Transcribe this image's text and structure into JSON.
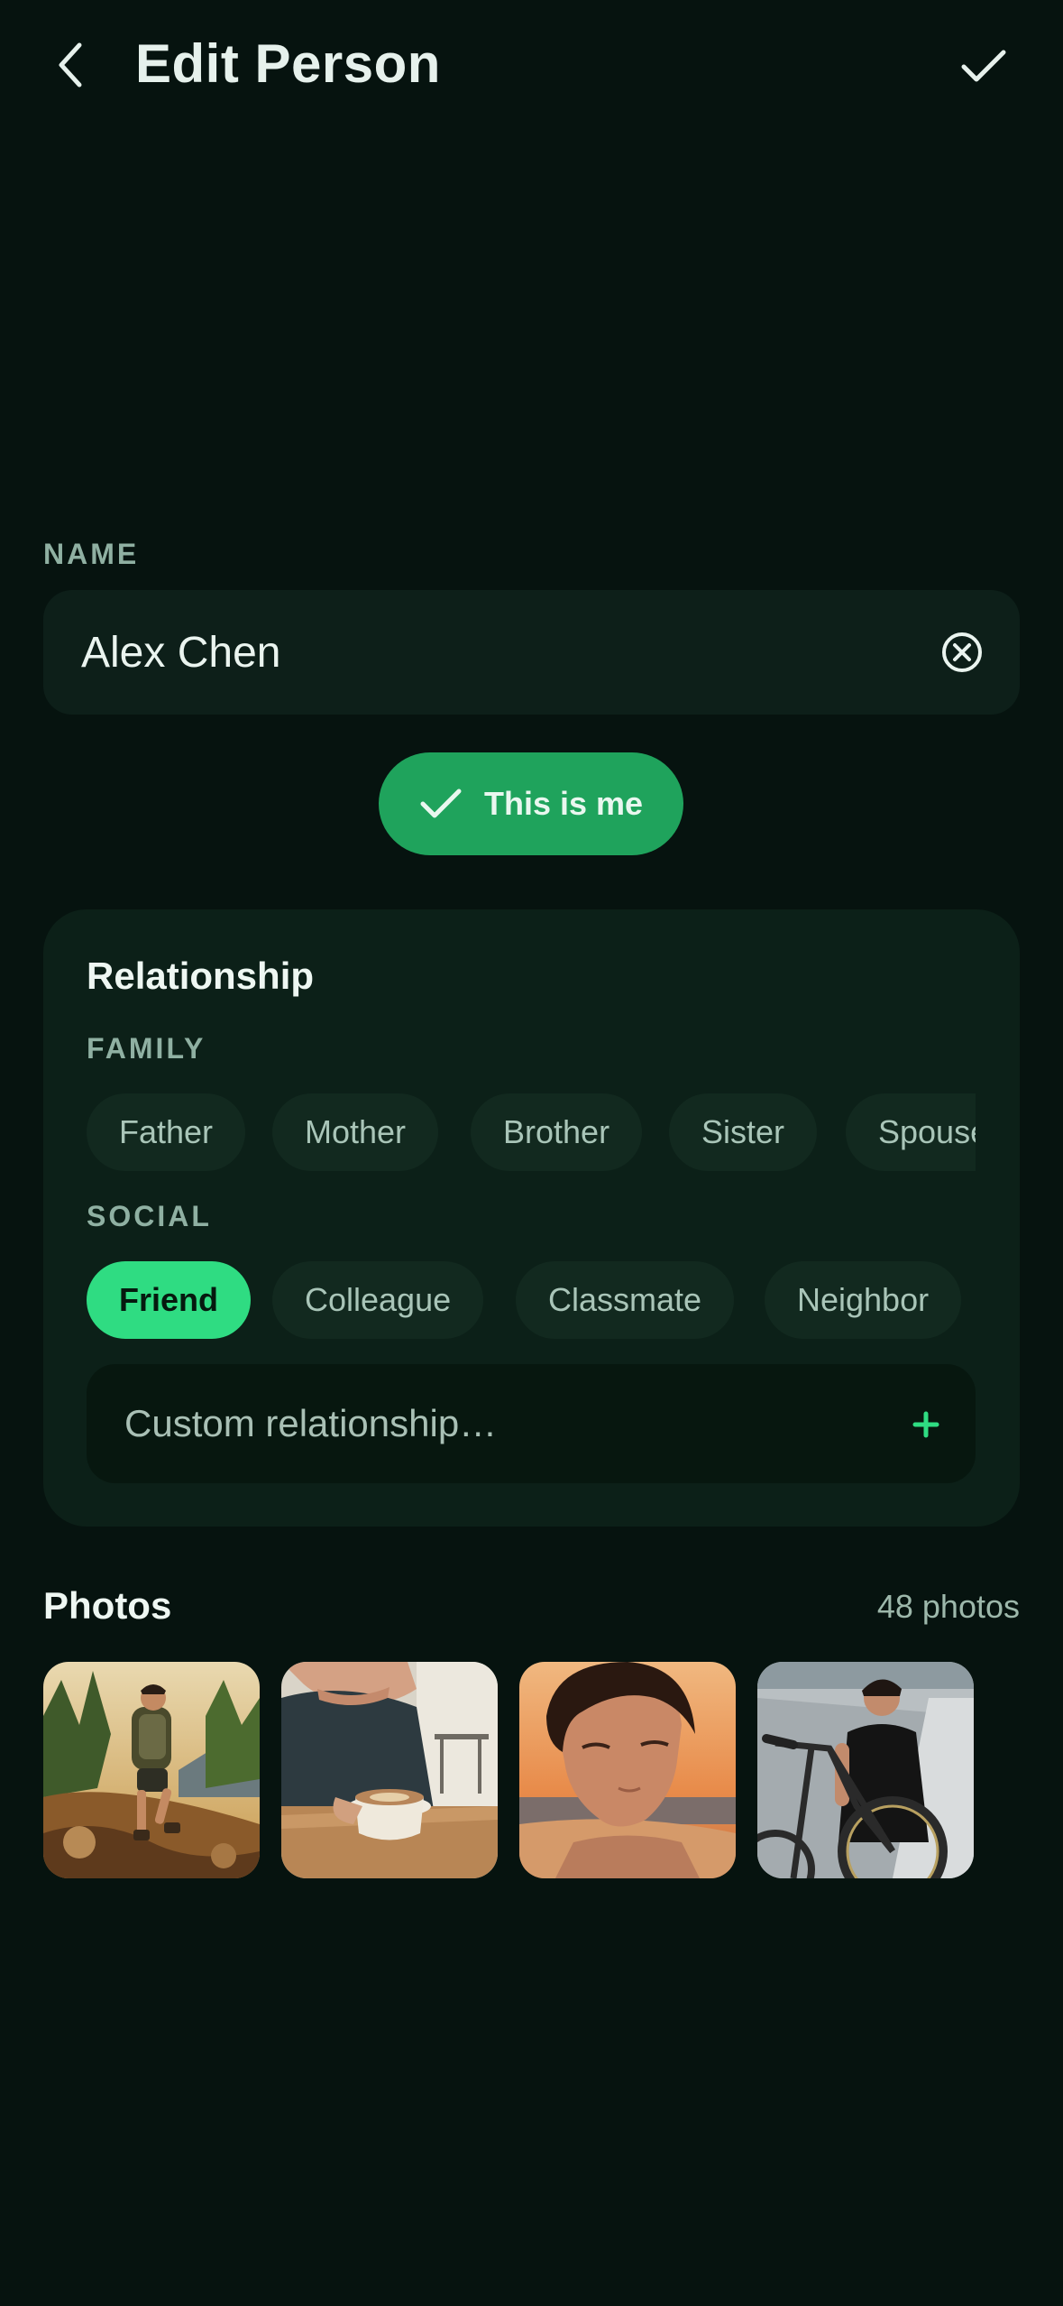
{
  "header": {
    "title": "Edit Person",
    "back_icon": "chevron-left-icon",
    "confirm_icon": "checkmark-icon"
  },
  "name": {
    "label": "NAME",
    "value": "Alex Chen",
    "clear_icon": "clear-circle-icon"
  },
  "this_is_me": {
    "label": "This is me",
    "icon": "checkmark-icon",
    "color": "#1fa35c"
  },
  "relationship": {
    "title": "Relationship",
    "family": {
      "label": "FAMILY",
      "options": [
        "Father",
        "Mother",
        "Brother",
        "Sister",
        "Spouse"
      ]
    },
    "social": {
      "label": "SOCIAL",
      "options": [
        "Friend",
        "Colleague",
        "Classmate",
        "Neighbor"
      ],
      "selected": "Friend"
    },
    "custom": {
      "placeholder": "Custom relationship…",
      "add_icon": "plus-icon"
    }
  },
  "photos": {
    "title": "Photos",
    "count": "48 photos",
    "items": [
      {
        "subject": "hiking-photo"
      },
      {
        "subject": "coffee-photo"
      },
      {
        "subject": "beach-sunset-photo"
      },
      {
        "subject": "bicycle-photo"
      }
    ]
  },
  "colors": {
    "background": "#06130f",
    "accent": "#2fdc82",
    "card": "#0c2018"
  }
}
